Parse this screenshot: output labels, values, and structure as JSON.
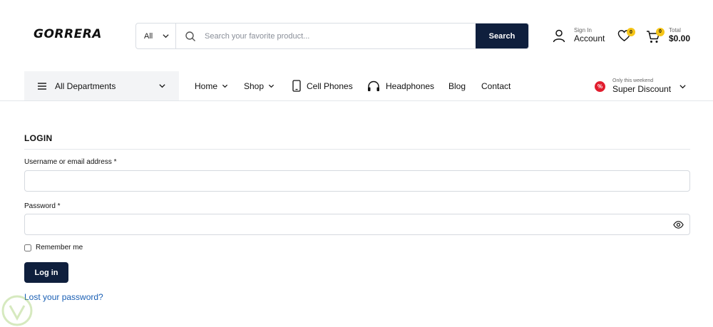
{
  "header": {
    "logo": "GORRERA",
    "search": {
      "category": "All",
      "placeholder": "Search your favorite product...",
      "button_label": "Search"
    },
    "account": {
      "small": "Sign In",
      "big": "Account"
    },
    "wishlist_count": "0",
    "cart": {
      "count": "0",
      "small": "Total",
      "big": "$0.00"
    }
  },
  "nav": {
    "departments": "All Departments",
    "items": [
      {
        "label": "Home"
      },
      {
        "label": "Shop"
      },
      {
        "label": "Cell Phones"
      },
      {
        "label": "Headphones"
      },
      {
        "label": "Blog"
      },
      {
        "label": "Contact"
      }
    ],
    "discount": {
      "small": "Only this weekend",
      "big": "Super Discount",
      "badge": "%"
    }
  },
  "login": {
    "title": "LOGIN",
    "username_label": "Username or email address *",
    "password_label": "Password *",
    "remember_label": "Remember me",
    "button_label": "Log in",
    "lost_password": "Lost your password?"
  },
  "colors": {
    "primary": "#0f1f3d",
    "badge": "#f5c518",
    "discount": "#e11d2e",
    "link": "#1a5fb4"
  }
}
